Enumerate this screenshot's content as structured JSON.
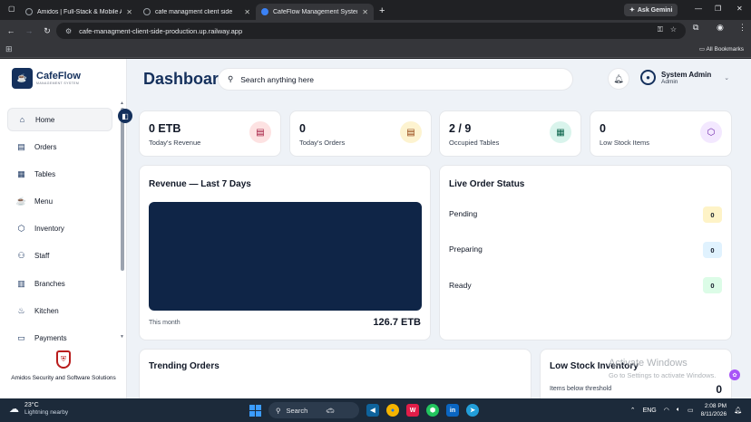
{
  "browser": {
    "tabs": [
      {
        "title": "Amidos | Full-Stack & Mobile A"
      },
      {
        "title": "cafe managment client side"
      },
      {
        "title": "CafeFlow Management System"
      }
    ],
    "new_tab": "+",
    "ask_gemini": "Ask Gemini",
    "url": "cafe-managment-client-side-production.up.railway.app",
    "all_bookmarks": "All Bookmarks"
  },
  "sidebar": {
    "brand": "CafeFlow",
    "brand_sub": "MANAGEMENT SYSTEM",
    "items": [
      {
        "label": "Home",
        "icon": "home-icon"
      },
      {
        "label": "Orders",
        "icon": "clipboard-icon"
      },
      {
        "label": "Tables",
        "icon": "table-icon"
      },
      {
        "label": "Menu",
        "icon": "cup-icon"
      },
      {
        "label": "Inventory",
        "icon": "box-icon"
      },
      {
        "label": "Staff",
        "icon": "users-icon"
      },
      {
        "label": "Branches",
        "icon": "building-icon"
      },
      {
        "label": "Kitchen",
        "icon": "chef-icon"
      },
      {
        "label": "Payments",
        "icon": "wallet-icon"
      }
    ],
    "footer": "Amidos Security and Software Solutions"
  },
  "header": {
    "title": "Dashboard",
    "search_placeholder": "Search anything here",
    "user_name": "System Admin",
    "user_role": "Admin"
  },
  "stats": [
    {
      "value": "0 ETB",
      "label": "Today's Revenue",
      "icon": "receipt-icon",
      "color": "#fde2e2"
    },
    {
      "value": "0",
      "label": "Today's Orders",
      "icon": "clipboard-icon",
      "color": "#fdf3d0"
    },
    {
      "value": "2 / 9",
      "label": "Occupied Tables",
      "icon": "table-icon",
      "color": "#d9f4ec"
    },
    {
      "value": "0",
      "label": "Low Stock Items",
      "icon": "box-icon",
      "color": "#f3e8ff"
    }
  ],
  "revenue": {
    "title": "Revenue — Last 7 Days",
    "period": "This month",
    "total": "126.7 ETB"
  },
  "live_orders": {
    "title": "Live Order Status",
    "rows": [
      {
        "label": "Pending",
        "count": "0",
        "color": "#fef3c7"
      },
      {
        "label": "Preparing",
        "count": "0",
        "color": "#e0f2fe"
      },
      {
        "label": "Ready",
        "count": "0",
        "color": "#dcfce7"
      }
    ]
  },
  "trending": {
    "title": "Trending Orders"
  },
  "low_stock": {
    "title": "Low Stock Inventory",
    "subtitle": "Items below threshold",
    "count": "0"
  },
  "watermark": {
    "line1": "Activate Windows",
    "line2": "Go to Settings to activate Windows."
  },
  "taskbar": {
    "temp": "23°C",
    "weather": "Lightning nearby",
    "search": "Search",
    "lang": "ENG",
    "time": "2:08 PM",
    "date": "8/11/2026"
  }
}
